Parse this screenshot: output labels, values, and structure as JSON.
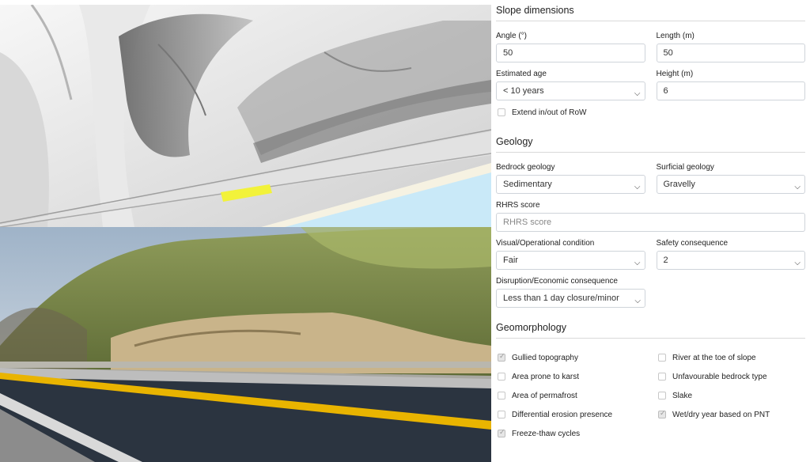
{
  "sections": {
    "slope": "Slope dimensions",
    "geology": "Geology",
    "geomorph": "Geomorphology"
  },
  "slope": {
    "angle": {
      "label": "Angle (°)",
      "value": "50"
    },
    "length": {
      "label": "Length (m)",
      "value": "50"
    },
    "age": {
      "label": "Estimated age",
      "value": "< 10 years"
    },
    "height": {
      "label": "Height (m)",
      "value": "6"
    },
    "extend": {
      "label": "Extend in/out of RoW",
      "checked": false
    }
  },
  "geology": {
    "bedrock": {
      "label": "Bedrock geology",
      "value": "Sedimentary"
    },
    "surficial": {
      "label": "Surficial geology",
      "value": "Gravelly"
    },
    "rhrs": {
      "label": "RHRS score",
      "placeholder": "RHRS score"
    },
    "visual": {
      "label": "Visual/Operational condition",
      "value": "Fair"
    },
    "safety": {
      "label": "Safety consequence",
      "value": "2"
    },
    "disruption": {
      "label": "Disruption/Economic consequence",
      "value": "Less than 1 day closure/minor"
    }
  },
  "geomorph": {
    "items": [
      {
        "label": "Gullied topography",
        "checked": true
      },
      {
        "label": "River at the toe of slope",
        "checked": false
      },
      {
        "label": "Area prone to karst",
        "checked": false
      },
      {
        "label": "Unfavourable bedrock type",
        "checked": false
      },
      {
        "label": "Area of permafrost",
        "checked": false
      },
      {
        "label": "Slake",
        "checked": false
      },
      {
        "label": "Differential erosion presence",
        "checked": false
      },
      {
        "label": "Wet/dry year based on PNT",
        "checked": true
      },
      {
        "label": "Freeze-thaw cycles",
        "checked": true
      }
    ]
  },
  "colors": {
    "highlight": "#f2f23a",
    "water": "#c9e9f8",
    "road": "#1f2733",
    "lane": "#e9b400"
  }
}
